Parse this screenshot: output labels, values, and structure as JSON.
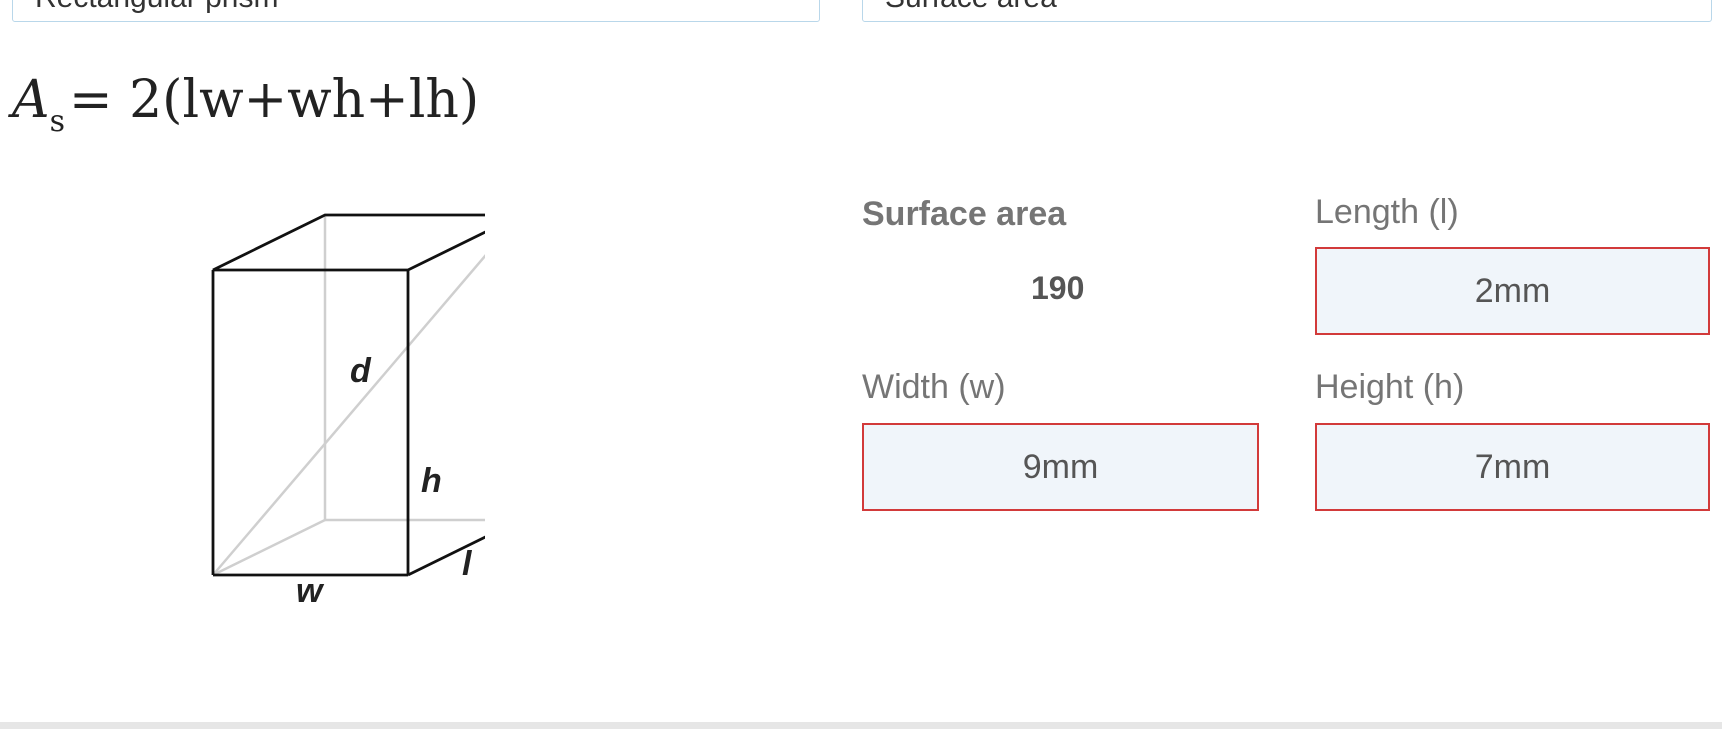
{
  "selectors": {
    "shape_value": "Rectangular prism",
    "calculate_value": "Surface area"
  },
  "formula": {
    "symbol": "A",
    "subscript": "s",
    "expression": "= 2(lw+wh+lh)"
  },
  "diagram": {
    "labels": {
      "diagonal": "d",
      "height": "h",
      "width": "w",
      "length": "l"
    }
  },
  "result": {
    "label": "Surface area",
    "value": "190"
  },
  "inputs": {
    "length": {
      "label": "Length (l)",
      "value": "2mm"
    },
    "width": {
      "label": "Width (w)",
      "value": "9mm"
    },
    "height": {
      "label": "Height (h)",
      "value": "7mm"
    }
  },
  "colors": {
    "input_border": "#d23a3a",
    "input_background": "#f0f5fa",
    "select_border": "#b9d7ea"
  }
}
